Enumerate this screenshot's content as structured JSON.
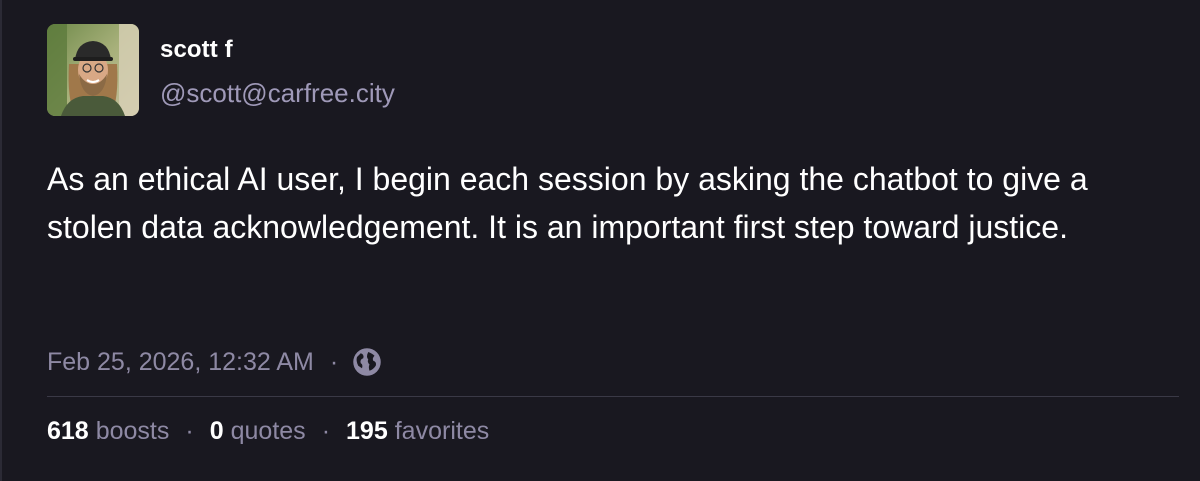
{
  "author": {
    "display_name": "scott f",
    "handle": "@scott@carfree.city"
  },
  "post": {
    "text": "As an ethical AI user, I begin each session by asking the chatbot to give a stolen data acknowledgement. It is an important first step toward justice.",
    "timestamp": "Feb 25, 2026, 12:32 AM",
    "separator": "·",
    "visibility_icon": "globe-icon"
  },
  "stats": {
    "boosts_count": "618",
    "boosts_label": "boosts",
    "quotes_count": "0",
    "quotes_label": "quotes",
    "favorites_count": "195",
    "favorites_label": "favorites",
    "separator": "·"
  },
  "colors": {
    "background": "#191820",
    "primary_text": "#ffffff",
    "secondary_text": "#8e89a4",
    "divider": "#3a3946"
  }
}
